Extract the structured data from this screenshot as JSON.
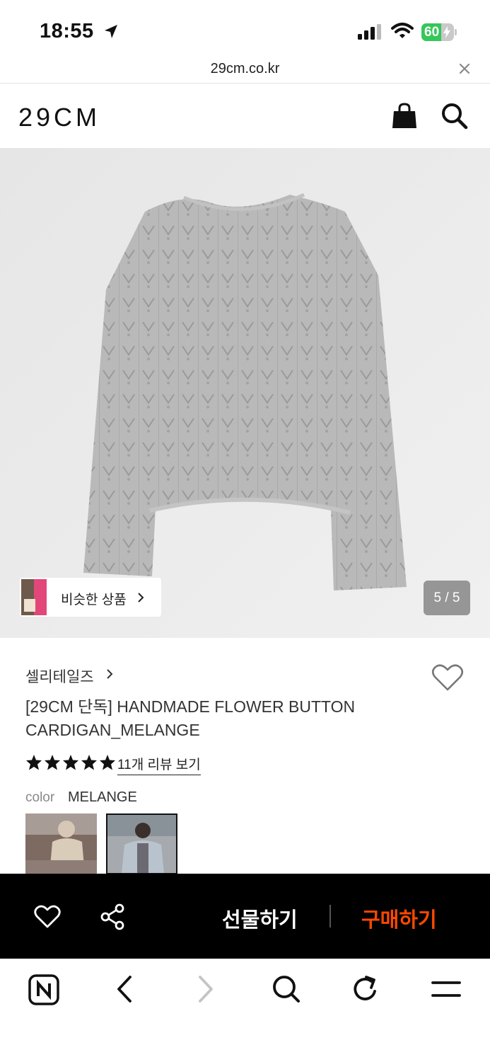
{
  "status_bar": {
    "time": "18:55",
    "battery_level": "60",
    "battery_fraction": 0.6,
    "battery_color": "#34c759"
  },
  "url_bar": {
    "url": "29cm.co.kr",
    "close_icon": "close-icon"
  },
  "header": {
    "logo": "29CM",
    "icons": [
      "shopping-bag-icon",
      "search-icon"
    ]
  },
  "gallery": {
    "similar_label": "비슷한 상품",
    "counter": "5 / 5",
    "background": "#ececec"
  },
  "product": {
    "brand": "셀리테일즈",
    "title": "[29CM 단독] HANDMADE FLOWER BUTTON CARDIGAN_MELANGE",
    "rating_stars": 5,
    "review_link": "11개 리뷰 보기",
    "color_label": "color",
    "color_value": "MELANGE"
  },
  "action_bar": {
    "gift_label": "선물하기",
    "buy_label": "구매하기",
    "buy_color": "#ff4800",
    "icons": [
      "heart-icon",
      "share-icon"
    ]
  },
  "toolbar": {
    "icons": [
      "naver-home-icon",
      "back-icon",
      "forward-icon",
      "search-icon",
      "refresh-icon",
      "menu-icon"
    ]
  }
}
